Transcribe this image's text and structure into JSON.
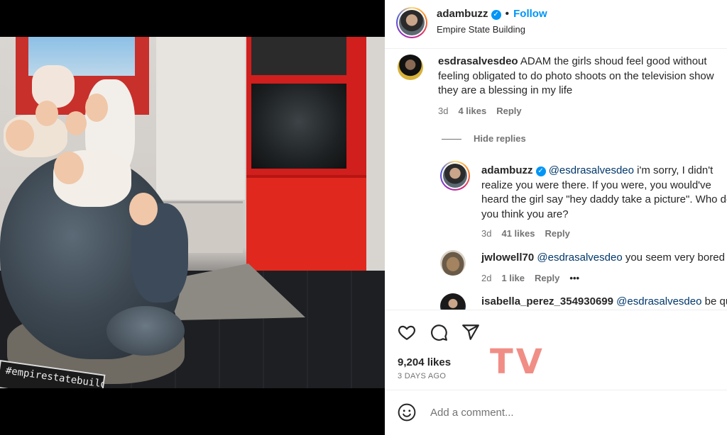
{
  "post": {
    "username": "adambuzz",
    "follow_label": "Follow",
    "separator": "•",
    "location": "Empire State Building",
    "photo_hashtag": "#empirestatebuilding",
    "likes": "9,204 likes",
    "time_ago": "3 DAYS AGO",
    "watermark": "TV",
    "add_comment_placeholder": "Add a comment..."
  },
  "comments": [
    {
      "username": "esdrasalvesdeo",
      "text": "ADAM the girls shoud feel good without feeling obligated to do photo shoots on the television show they are a blessing in my life",
      "age": "3d",
      "likes": "4 likes",
      "reply_label": "Reply"
    }
  ],
  "hide_replies_label": "Hide replies",
  "replies": [
    {
      "username": "adambuzz",
      "mention": "@esdrasalvesdeo",
      "text": "i'm sorry, I didn't realize you were there. If you were, you would've heard the girl say \"hey daddy take a picture\". Who do you think you are?",
      "age": "3d",
      "likes": "41 likes",
      "reply_label": "Reply"
    },
    {
      "username": "jwlowell70",
      "mention": "@esdrasalvesdeo",
      "text": "you seem very bored",
      "age": "2d",
      "likes": "1 like",
      "reply_label": "Reply",
      "more": "•••"
    },
    {
      "username": "isabella_perez_354930699",
      "mention": "@esdrasalvesdeo",
      "text": "be quiet"
    }
  ],
  "icons": {
    "like": "heart-icon",
    "comment": "comment-icon",
    "share": "share-icon",
    "emoji": "emoji-icon",
    "verified": "verified-badge-icon"
  },
  "colors": {
    "accent": "#0095f6",
    "muted": "#737373",
    "text": "#262626",
    "watermark": "#f08e86"
  }
}
